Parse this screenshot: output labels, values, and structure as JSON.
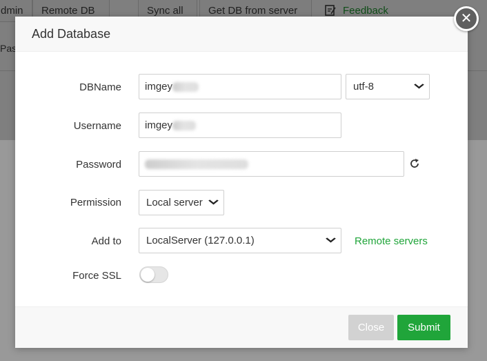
{
  "background": {
    "toolbar": {
      "admin_label": "dmin",
      "remote_db_label": "Remote DB",
      "sync_all_label": "Sync all",
      "get_db_label": "Get DB from server",
      "feedback_label": "Feedback"
    },
    "row2_text": "Pas"
  },
  "modal": {
    "title": "Add Database",
    "fields": {
      "dbname": {
        "label": "DBName",
        "value": "imgey"
      },
      "charset": {
        "value": "utf-8"
      },
      "username": {
        "label": "Username",
        "value": "imgey"
      },
      "password": {
        "label": "Password",
        "value": ""
      },
      "permission": {
        "label": "Permission",
        "value": "Local server"
      },
      "add_to": {
        "label": "Add to",
        "value": "LocalServer (127.0.0.1)",
        "link": "Remote servers"
      },
      "force_ssl": {
        "label": "Force SSL",
        "enabled": false
      }
    },
    "buttons": {
      "close": "Close",
      "submit": "Submit"
    }
  },
  "colors": {
    "accent": "#20a53a",
    "disabled_button": "#d2d2d2"
  }
}
